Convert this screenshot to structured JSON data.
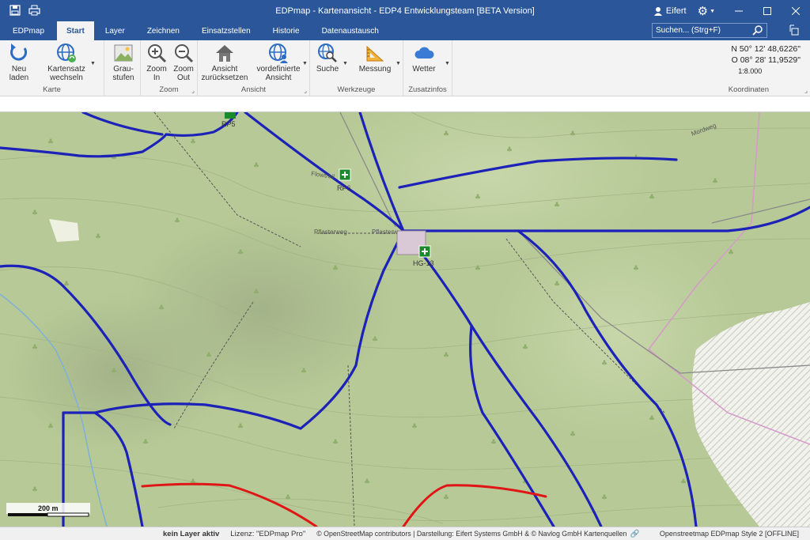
{
  "window": {
    "title": "EDPmap - Kartenansicht - EDP4 Entwicklungsteam  [BETA Version]",
    "user": "Eifert"
  },
  "menu": {
    "tabs": [
      "EDPmap",
      "Start",
      "Layer",
      "Zeichnen",
      "Einsatzstellen",
      "Historie",
      "Datenaustausch"
    ],
    "search_placeholder": "Suchen... (Strg+F)"
  },
  "ribbon": {
    "groups": {
      "karte": "Karte",
      "zoom": "Zoom",
      "ansicht": "Ansicht",
      "werkzeuge": "Werkzeuge",
      "zusatzinfos": "Zusatzinfos",
      "koordinaten": "Koordinaten"
    },
    "buttons": {
      "neu_laden_1": "Neu",
      "neu_laden_2": "laden",
      "kartensatz_1": "Kartensatz",
      "kartensatz_2": "wechseln",
      "grau_1": "Grau-",
      "grau_2": "stufen",
      "zoom_in_1": "Zoom",
      "zoom_in_2": "In",
      "zoom_out_1": "Zoom",
      "zoom_out_2": "Out",
      "ansicht_1": "Ansicht",
      "ansicht_2": "zurücksetzen",
      "vordef_1": "vordefinierte",
      "vordef_2": "Ansicht",
      "suche": "Suche",
      "messung": "Messung",
      "wetter": "Wetter"
    },
    "coords": {
      "lat": "N 50° 12' 48,6226\"",
      "lon": "O 08° 28' 11,9529\"",
      "scale": "1:8.000"
    }
  },
  "map": {
    "labels": {
      "rp5": "RP5",
      "rp6": "RP6",
      "hg": "HG-13",
      "pflasterweg1": "Pflasterweg",
      "pflasterweg2": "Pflasterw",
      "flowtrail": "Flowtrail",
      "mordweg": "Mordweg"
    },
    "scalebar": "200 m"
  },
  "status": {
    "layer": "kein Layer aktiv",
    "license": "Lizenz: \"EDPmap Pro\"",
    "attribution": "© OpenStreetMap contributors | Darstellung: Eifert Systems GmbH & © Navlog GmbH Kartenquellen",
    "style": "Openstreetmap EDPmap Style 2 [OFFLINE]"
  },
  "colors": {
    "titlebar": "#2b579a",
    "route_blue": "#1c22b8",
    "route_red": "#e01515",
    "map_green": "#b6c996"
  }
}
